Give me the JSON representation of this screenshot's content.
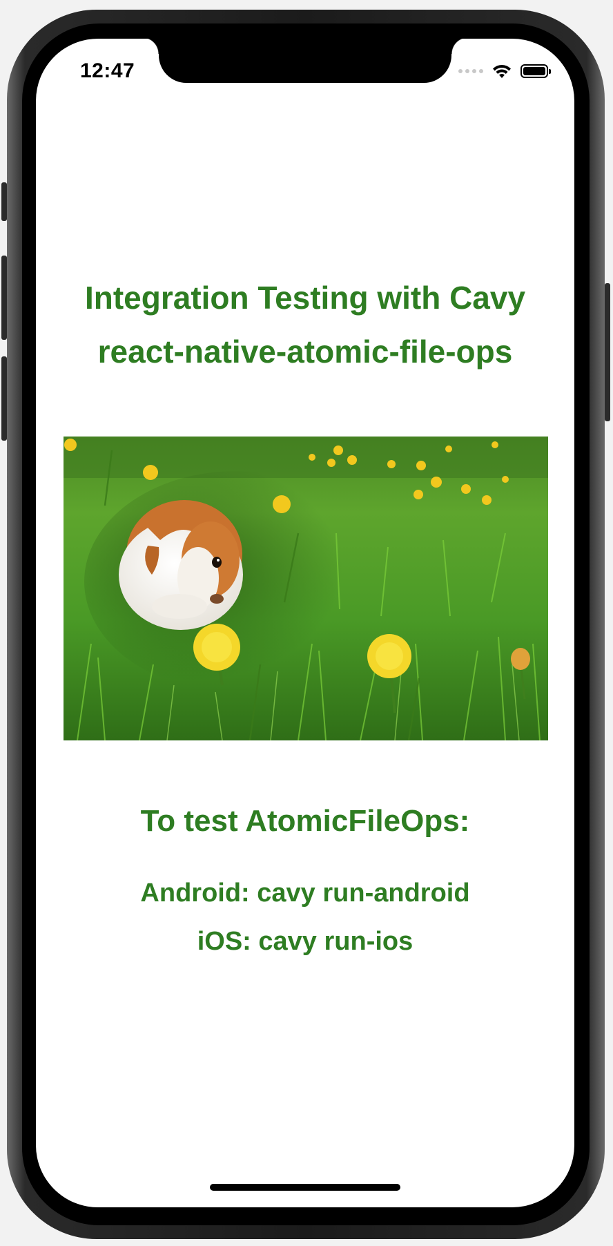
{
  "status_bar": {
    "time": "12:47",
    "wifi_icon": "wifi-icon",
    "battery_icon": "battery-icon",
    "signal_icon": "cellular-signal-icon"
  },
  "header": {
    "line1": "Integration Testing with Cavy",
    "line2": "react-native-atomic-file-ops"
  },
  "image": {
    "subject": "guinea pig in grass with dandelions"
  },
  "instructions": {
    "heading": "To test AtomicFileOps:",
    "android": "Android: cavy run-android",
    "ios": "iOS: cavy run-ios"
  },
  "colors": {
    "accent": "#2e7d22",
    "background": "#ffffff"
  }
}
